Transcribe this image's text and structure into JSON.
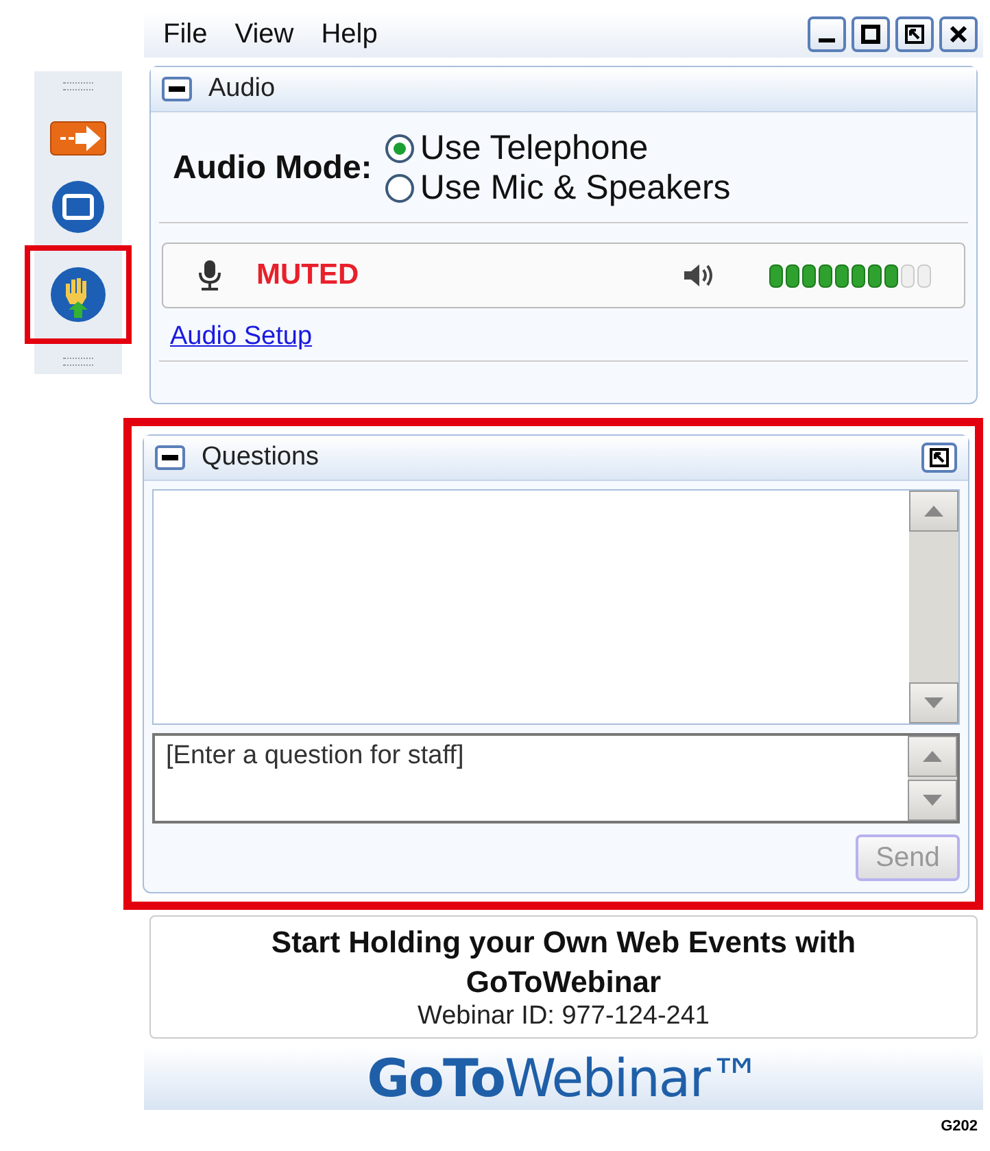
{
  "menu": [
    "File",
    "View",
    "Help"
  ],
  "window_buttons": [
    {
      "kind": "minimize"
    },
    {
      "kind": "maximize"
    },
    {
      "kind": "restore"
    },
    {
      "kind": "close"
    }
  ],
  "sidebar": {
    "items": [
      {
        "kind": "arrow",
        "highlighted": false
      },
      {
        "kind": "screen",
        "highlighted": false
      },
      {
        "kind": "hand",
        "highlighted": true
      }
    ]
  },
  "audio": {
    "title": "Audio",
    "mode_label": "Audio Mode:",
    "options": [
      {
        "label": "Use Telephone",
        "selected": true
      },
      {
        "label": "Use Mic & Speakers",
        "selected": false
      }
    ],
    "mic_status": "MUTED",
    "speaker": {
      "level": 0.8
    },
    "setup_link": "Audio Setup"
  },
  "questions": {
    "title": "Questions",
    "highlighted": true,
    "input": {
      "placeholder": "[Enter a question for staff]"
    },
    "send": {
      "label": "Send",
      "disabled": true
    }
  },
  "promo": {
    "headline": "Start Holding your Own Web Events with GoToWebinar",
    "webinar_id": "Webinar ID: 977-124-241"
  },
  "logo": "**GoTo**Webinar™",
  "code": "G202"
}
